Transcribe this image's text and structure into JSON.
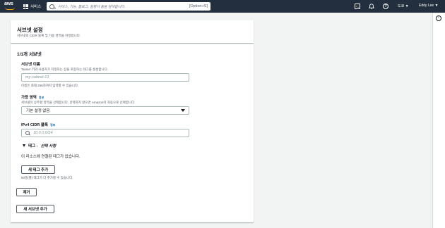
{
  "topnav": {
    "logo_text": "aws",
    "services_label": "서비스",
    "search_placeholder": "서비스, 기능, 블로그, 설명서 등을 검색합니다.",
    "search_shortcut": "[Option+S]",
    "region_label": "도쿄 ▼",
    "user_label": "Eddy Lee ▼",
    "icons": [
      "cloudshell-icon",
      "notifications-icon",
      "help-icon"
    ],
    "background_color": "#232f3e"
  },
  "header_panel": {
    "title": "서브넷 설정",
    "description": "서브넷의 CIDR 블록 및 가용 영역을 지정합니다."
  },
  "subnet_section": {
    "title": "1/1개 서브넷",
    "name_label": "서브넷 이름",
    "name_description": "'Name' 키와 사용자가 지정하는 값을 포함하는 태그를 생성합니다.",
    "name_placeholder": "my-subnet-01",
    "name_hint": "이름은 최대 256자까지 입력할 수 있습니다.",
    "az_label": "가용 영역",
    "az_info": "정보",
    "az_description": "서브넷이 상주할 영역을 선택합니다. 선택하지 않으면 Amazon이 자동으로 선택합니다.",
    "az_selected": "기본 설정 없음",
    "cidr_label": "IPv4 CIDR 블록",
    "cidr_info": "정보",
    "cidr_placeholder": "10.0.0.0/24",
    "tags_toggle_label": "태그 -",
    "tags_toggle_optional": "선택 사항",
    "no_tags_text": "이 리소스에 연결된 태그가 없습니다.",
    "add_tag_button": "새 태그 추가",
    "tags_hint": "50중(를) 태그가 더 추가할 수 있습니다.",
    "remove_button": "제거"
  },
  "add_subnet_button": "새 서브넷 추가"
}
